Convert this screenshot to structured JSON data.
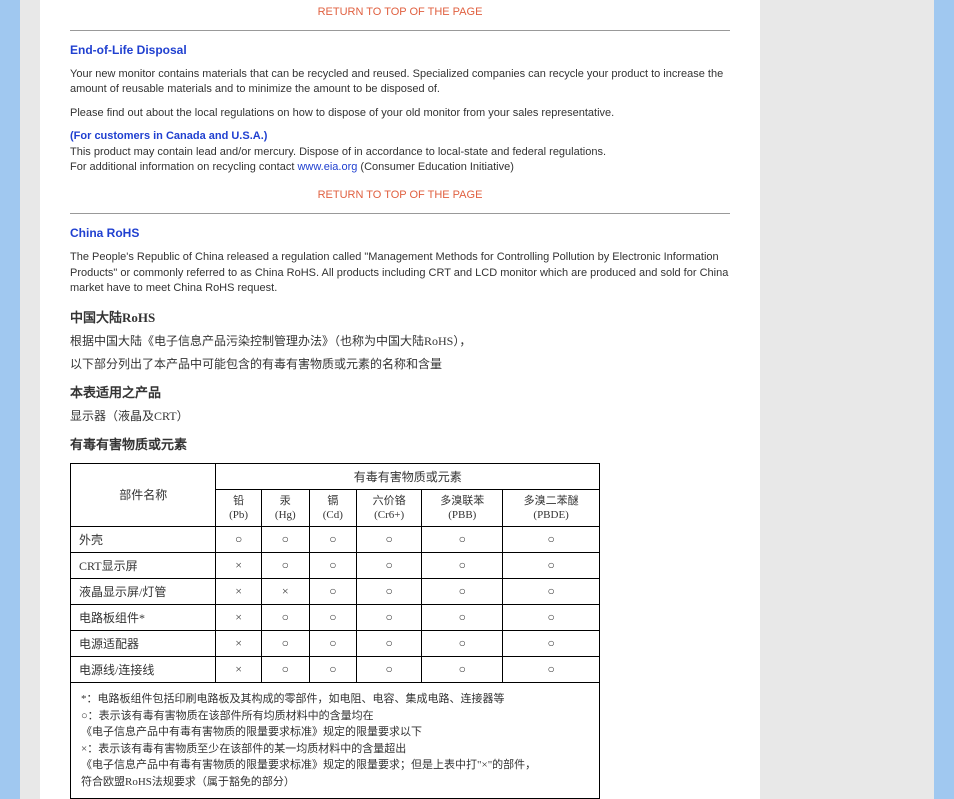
{
  "returnTop": "RETURN TO TOP OF THE PAGE",
  "eol": {
    "heading": "End-of-Life Disposal",
    "p1": "Your new monitor contains materials that can be recycled and reused. Specialized companies can recycle your product to increase the amount of reusable materials and to minimize the amount to be disposed of.",
    "p2": "Please find out about the local regulations on how to dispose of your old monitor from your sales representative.",
    "usca_head": "(For customers in Canada and U.S.A.)",
    "usca_p1": "This product may contain lead and/or mercury. Dispose of in accordance to local-state and federal regulations.",
    "usca_p2a": "For additional information on recycling contact ",
    "usca_link": "www.eia.org",
    "usca_p2b": " (Consumer Education Initiative)"
  },
  "rohs": {
    "heading": "China RoHS",
    "intro": "The People's Republic of China released a regulation called \"Management Methods for Controlling Pollution by Electronic Information Products\" or commonly referred to as China RoHS. All products including CRT and LCD monitor which are produced and sold for China market have to meet China RoHS request.",
    "cn_head1": "中国大陆RoHS",
    "cn_line1": "根据中国大陆《电子信息产品污染控制管理办法》（也称为中国大陆RoHS），",
    "cn_line2": "以下部分列出了本产品中可能包含的有毒有害物质或元素的名称和含量",
    "cn_head2": "本表适用之产品",
    "cn_line3": "显示器（液晶及CRT）",
    "cn_head3": "有毒有害物质或元素",
    "table": {
      "th_part": "部件名称",
      "th_group": "有毒有害物质或元素",
      "cols": [
        {
          "name": "铅",
          "sym": "(Pb)"
        },
        {
          "name": "汞",
          "sym": "(Hg)"
        },
        {
          "name": "镉",
          "sym": "(Cd)"
        },
        {
          "name": "六价铬",
          "sym": "(Cr6+)"
        },
        {
          "name": "多溴联苯",
          "sym": "(PBB)"
        },
        {
          "name": "多溴二苯醚",
          "sym": "(PBDE)"
        }
      ],
      "rows": [
        {
          "part": "外壳",
          "vals": [
            "○",
            "○",
            "○",
            "○",
            "○",
            "○"
          ]
        },
        {
          "part": "CRT显示屏",
          "vals": [
            "×",
            "○",
            "○",
            "○",
            "○",
            "○"
          ]
        },
        {
          "part": "液晶显示屏/灯管",
          "vals": [
            "×",
            "×",
            "○",
            "○",
            "○",
            "○"
          ]
        },
        {
          "part": "电路板组件*",
          "vals": [
            "×",
            "○",
            "○",
            "○",
            "○",
            "○"
          ]
        },
        {
          "part": "电源适配器",
          "vals": [
            "×",
            "○",
            "○",
            "○",
            "○",
            "○"
          ]
        },
        {
          "part": "电源线/连接线",
          "vals": [
            "×",
            "○",
            "○",
            "○",
            "○",
            "○"
          ]
        }
      ],
      "notes": "*：电路板组件包括印刷电路板及其构成的零部件，如电阻、电容、集成电路、连接器等\n○：表示该有毒有害物质在该部件所有均质材料中的含量均在\n《电子信息产品中有毒有害物质的限量要求标准》规定的限量要求以下\n×：表示该有毒有害物质至少在该部件的某一均质材料中的含量超出\n《电子信息产品中有毒有害物质的限量要求标准》规定的限量要求；但是上表中打\"×\"的部件，\n符合欧盟RoHS法规要求（属于豁免的部分）"
    }
  }
}
